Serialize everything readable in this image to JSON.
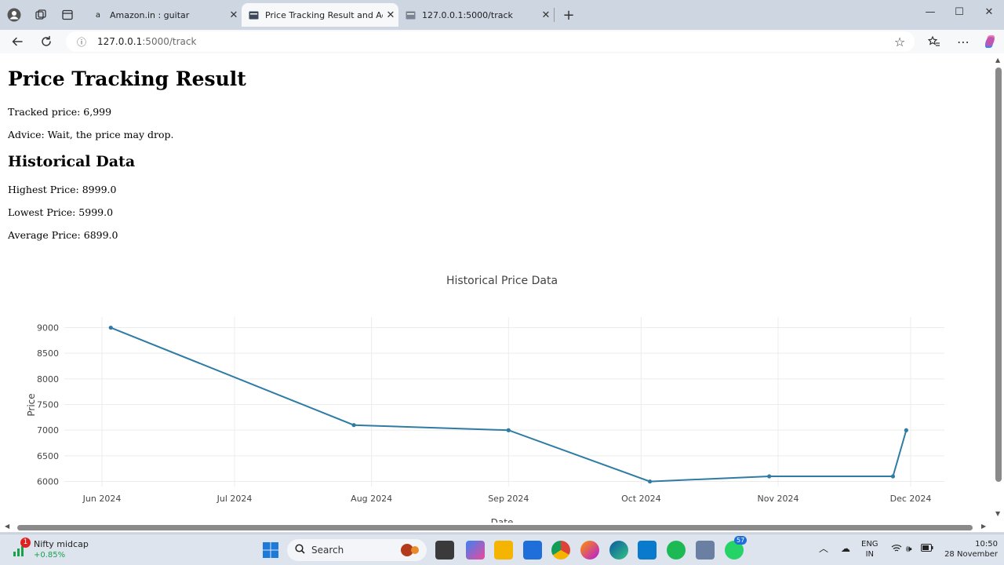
{
  "browser": {
    "tabs": [
      {
        "title": "Amazon.in : guitar",
        "favicon": "a"
      },
      {
        "title": "Price Tracking Result and Advice P",
        "favicon": "▪"
      },
      {
        "title": "127.0.0.1:5000/track",
        "favicon": "▪"
      }
    ],
    "new_tab": "+",
    "url_host": "127.0.0.1",
    "url_path": ":5000/track"
  },
  "page": {
    "title": "Price Tracking Result",
    "tracked_price": "Tracked price: 6,999",
    "advice": "Advice: Wait, the price may drop.",
    "historical_heading": "Historical Data",
    "highest": "Highest Price: 8999.0",
    "lowest": "Lowest Price: 5999.0",
    "average": "Average Price: 6899.0"
  },
  "chart_data": {
    "type": "line",
    "title": "Historical Price Data",
    "xlabel": "Date",
    "ylabel": "Price",
    "color": "#2e7ca4",
    "x_tick_labels": [
      "Jun 2024",
      "Jul 2024",
      "Aug 2024",
      "Sep 2024",
      "Oct 2024",
      "Nov 2024",
      "Dec 2024"
    ],
    "y_tick_labels": [
      "6000",
      "6500",
      "7000",
      "7500",
      "8000",
      "8500",
      "9000"
    ],
    "ylim": [
      5950,
      9200
    ],
    "grid": true,
    "points": [
      {
        "x": "2024-06-03",
        "y": 8999
      },
      {
        "x": "2024-07-28",
        "y": 7099
      },
      {
        "x": "2024-09-01",
        "y": 6999
      },
      {
        "x": "2024-10-03",
        "y": 5999
      },
      {
        "x": "2024-10-30",
        "y": 6099
      },
      {
        "x": "2024-11-27",
        "y": 6099
      },
      {
        "x": "2024-11-30",
        "y": 6999
      }
    ]
  },
  "taskbar": {
    "widget_title": "Nifty midcap",
    "widget_value": "+0.85%",
    "widget_badge": "1",
    "search_label": "Search",
    "whatsapp_badge": "57",
    "lang_top": "ENG",
    "lang_bottom": "IN",
    "time": "10:50",
    "date": "28 November"
  }
}
